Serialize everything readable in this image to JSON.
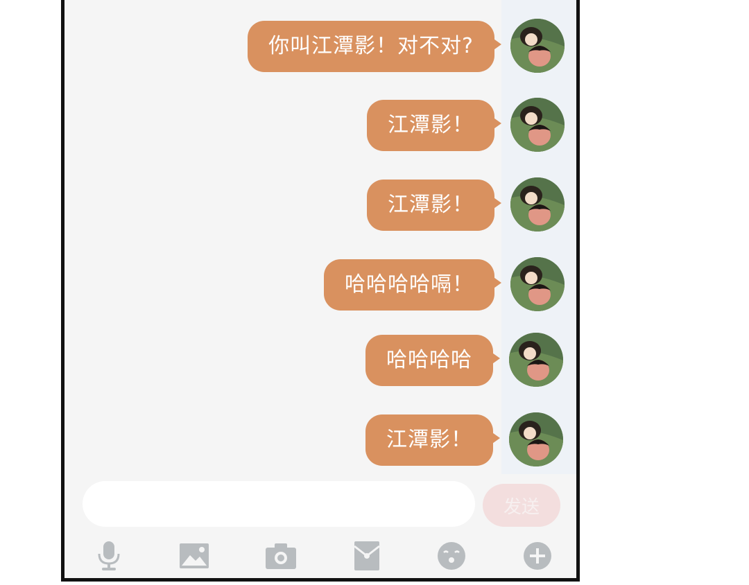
{
  "messages": [
    {
      "text": "你叫江潭影！对不对?",
      "sender": "self"
    },
    {
      "text": "江潭影！",
      "sender": "self"
    },
    {
      "text": "江潭影！",
      "sender": "self"
    },
    {
      "text": "哈哈哈哈嗝！",
      "sender": "self"
    },
    {
      "text": "哈哈哈哈",
      "sender": "self"
    },
    {
      "text": "江潭影！",
      "sender": "self"
    }
  ],
  "composer": {
    "input_value": "",
    "send_label": "发送"
  },
  "toolbar": {
    "icons": [
      "microphone-icon",
      "image-icon",
      "camera-icon",
      "red-packet-icon",
      "emoji-icon",
      "plus-icon"
    ]
  },
  "colors": {
    "bubble": "#d9915f",
    "bubble_text": "#ffffff",
    "background": "#f5f5f5",
    "send_button": "#f3dede",
    "toolbar_icon": "#b8bcbf"
  }
}
